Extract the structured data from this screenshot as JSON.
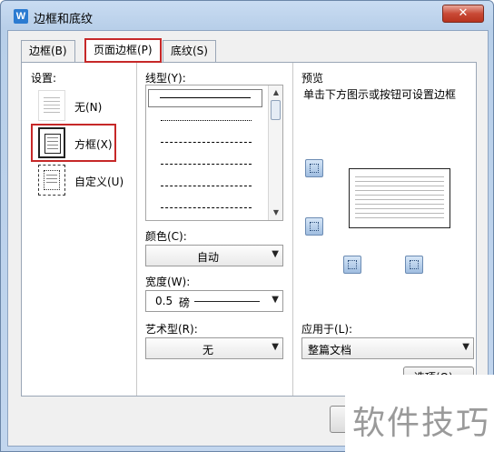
{
  "window": {
    "title": "边框和底纹",
    "app_icon_letter": "W",
    "close_glyph": "✕"
  },
  "tabs": [
    {
      "label": "边框(B)",
      "active": false
    },
    {
      "label": "页面边框(P)",
      "active": true
    },
    {
      "label": "底纹(S)",
      "active": false
    }
  ],
  "setting": {
    "label": "设置:",
    "items": [
      {
        "label": "无(N)",
        "icon": "none-border-icon"
      },
      {
        "label": "方框(X)",
        "icon": "box-border-icon",
        "selected": true
      },
      {
        "label": "自定义(U)",
        "icon": "custom-border-icon"
      }
    ]
  },
  "line_style": {
    "label": "线型(Y):",
    "options": [
      "solid",
      "dotted",
      "dashed",
      "dash-dot",
      "dash-dot-dot",
      "long-dash-dot"
    ]
  },
  "color": {
    "label": "颜色(C):",
    "value": "自动"
  },
  "width": {
    "label": "宽度(W):",
    "value": "0.5",
    "unit": "磅"
  },
  "art": {
    "label": "艺术型(R):",
    "value": "无"
  },
  "preview": {
    "label": "预览",
    "hint": "单击下方图示或按钮可设置边框"
  },
  "apply_to": {
    "label": "应用于(L):",
    "value": "整篇文档"
  },
  "options_button": "选项(O)...",
  "watermark_text": "软件技巧",
  "colors": {
    "highlight": "#c62828",
    "accent": "#2b7bd1"
  }
}
